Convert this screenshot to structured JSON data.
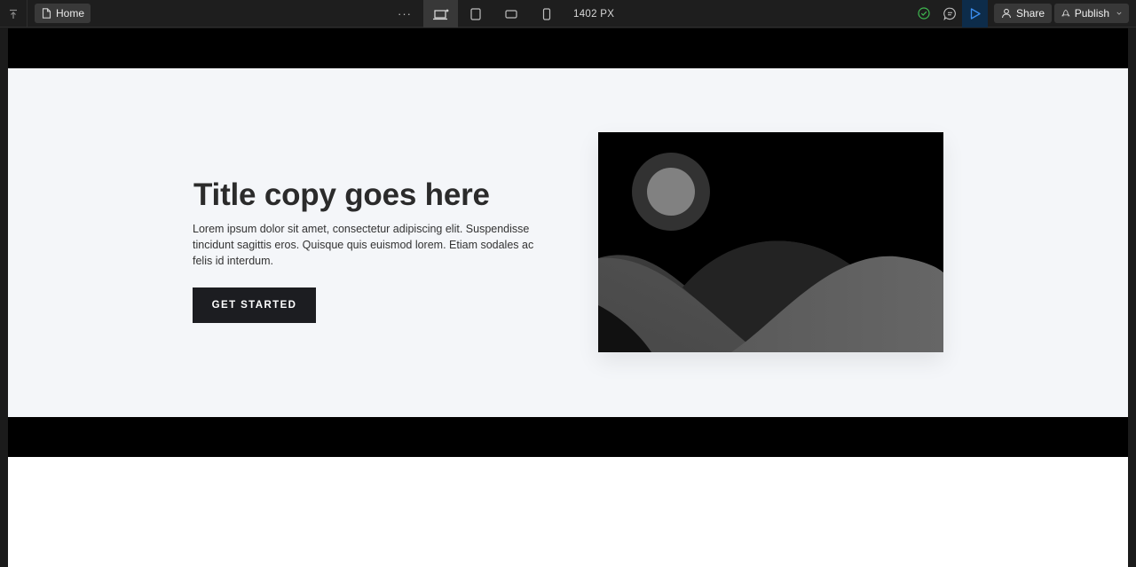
{
  "toolbar": {
    "page_label": "Home",
    "more_label": "···",
    "width_value": "1402",
    "width_unit": "PX",
    "share_label": "Share",
    "publish_label": "Publish"
  },
  "hero": {
    "title": "Title copy goes here",
    "body": "Lorem ipsum dolor sit amet, consectetur adipiscing elit. Suspendisse tincidunt sagittis eros. Quisque quis euismod lorem. Etiam sodales ac felis id interdum.",
    "cta_label": "GET STARTED"
  },
  "icons": {
    "collapse": "collapse-up-icon",
    "page": "page-icon",
    "desktop": "desktop-breakpoint-icon",
    "tablet": "tablet-breakpoint-icon",
    "mobile_landscape": "mobile-landscape-breakpoint-icon",
    "mobile_portrait": "mobile-portrait-breakpoint-icon",
    "status": "check-circle-icon",
    "comments": "comment-icon",
    "preview": "play-icon",
    "share": "user-icon",
    "publish": "publish-icon",
    "chevron": "chevron-down-icon"
  },
  "colors": {
    "toolbar_bg": "#1e1e1e",
    "accent_blue": "#3b8ef0",
    "status_green": "#3fb950",
    "hero_bg": "#f4f6f9",
    "cta_bg": "#1c1d21"
  }
}
